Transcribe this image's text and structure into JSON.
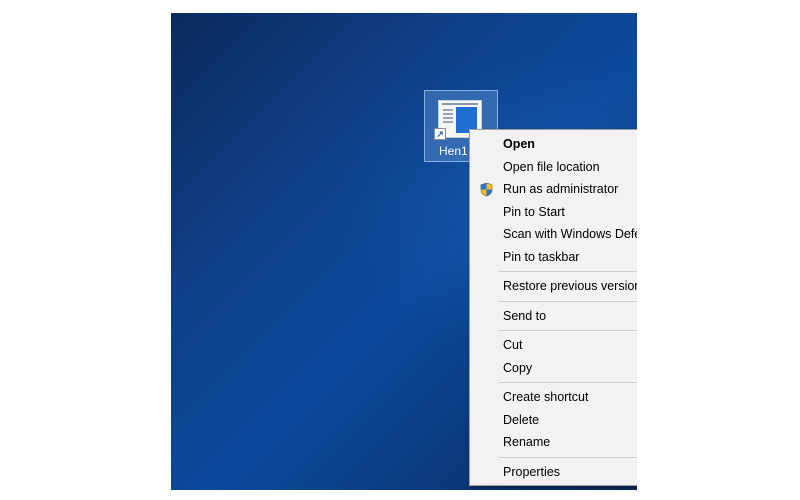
{
  "desktop": {
    "icon": {
      "label": "Hen1"
    }
  },
  "context_menu": {
    "groups": [
      [
        {
          "label": "Open",
          "bold": true
        },
        {
          "label": "Open file location"
        },
        {
          "label": "Run as administrator",
          "icon": "shield-icon"
        },
        {
          "label": "Pin to Start"
        },
        {
          "label": "Scan with Windows Defender..."
        },
        {
          "label": "Pin to taskbar"
        }
      ],
      [
        {
          "label": "Restore previous versions"
        }
      ],
      [
        {
          "label": "Send to",
          "icon": "chevron-right-icon"
        }
      ],
      [
        {
          "label": "Cut"
        },
        {
          "label": "Copy"
        }
      ],
      [
        {
          "label": "Create shortcut"
        },
        {
          "label": "Delete"
        },
        {
          "label": "Rename"
        }
      ],
      [
        {
          "label": "Properties"
        }
      ]
    ]
  }
}
